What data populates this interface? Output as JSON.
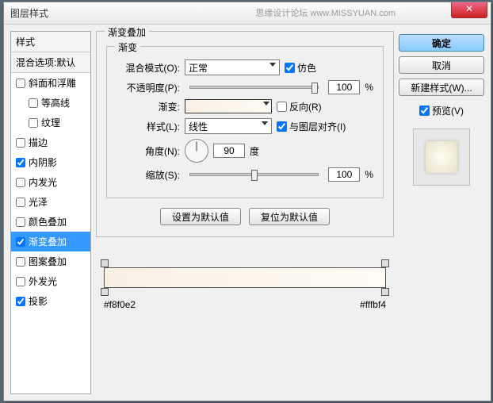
{
  "window": {
    "title": "图层样式",
    "watermark": "思缘设计论坛 www.MISSYUAN.com"
  },
  "styles_panel": {
    "header": "样式",
    "subheader": "混合选项:默认",
    "items": [
      {
        "label": "斜面和浮雕",
        "checked": false,
        "indent": false
      },
      {
        "label": "等高线",
        "checked": false,
        "indent": true
      },
      {
        "label": "纹理",
        "checked": false,
        "indent": true
      },
      {
        "label": "描边",
        "checked": false,
        "indent": false
      },
      {
        "label": "内阴影",
        "checked": true,
        "indent": false
      },
      {
        "label": "内发光",
        "checked": false,
        "indent": false
      },
      {
        "label": "光泽",
        "checked": false,
        "indent": false
      },
      {
        "label": "颜色叠加",
        "checked": false,
        "indent": false
      },
      {
        "label": "渐变叠加",
        "checked": true,
        "indent": false,
        "selected": true
      },
      {
        "label": "图案叠加",
        "checked": false,
        "indent": false
      },
      {
        "label": "外发光",
        "checked": false,
        "indent": false
      },
      {
        "label": "投影",
        "checked": true,
        "indent": false
      }
    ]
  },
  "gradient_overlay": {
    "title": "渐变叠加",
    "section": "渐变",
    "blend_label": "混合模式(O):",
    "blend_value": "正常",
    "dither_label": "仿色",
    "dither_checked": true,
    "opacity_label": "不透明度(P):",
    "opacity_value": "100",
    "pct": "%",
    "gradient_label": "渐变:",
    "reverse_label": "反向(R)",
    "reverse_checked": false,
    "style_label": "样式(L):",
    "style_value": "线性",
    "align_label": "与图层对齐(I)",
    "align_checked": true,
    "angle_label": "角度(N):",
    "angle_value": "90",
    "angle_unit": "度",
    "scale_label": "缩放(S):",
    "scale_value": "100",
    "set_default": "设置为默认值",
    "reset_default": "复位为默认值"
  },
  "gradient_stops": {
    "left_color": "#f8f0e2",
    "right_color": "#fffbf4"
  },
  "buttons": {
    "ok": "确定",
    "cancel": "取消",
    "new_style": "新建样式(W)...",
    "preview_label": "预览(V)",
    "preview_checked": true
  }
}
